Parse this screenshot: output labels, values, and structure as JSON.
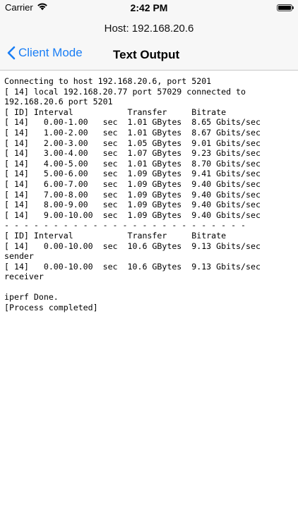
{
  "status_bar": {
    "carrier": "Carrier",
    "time": "2:42 PM",
    "wifi_icon": "wifi-icon",
    "battery_icon": "battery-icon"
  },
  "nav": {
    "host": "Host: 192.168.20.6",
    "back_label": "Client Mode",
    "title": "Text Output",
    "accent": "#1a7ef5"
  },
  "output_lines": [
    "Connecting to host 192.168.20.6, port 5201",
    "[ 14] local 192.168.20.77 port 57029 connected to",
    "192.168.20.6 port 5201",
    "[ ID] Interval           Transfer     Bitrate",
    "[ 14]   0.00-1.00   sec  1.01 GBytes  8.65 Gbits/sec",
    "[ 14]   1.00-2.00   sec  1.01 GBytes  8.67 Gbits/sec",
    "[ 14]   2.00-3.00   sec  1.05 GBytes  9.01 Gbits/sec",
    "[ 14]   3.00-4.00   sec  1.07 GBytes  9.23 Gbits/sec",
    "[ 14]   4.00-5.00   sec  1.01 GBytes  8.70 Gbits/sec",
    "[ 14]   5.00-6.00   sec  1.09 GBytes  9.41 Gbits/sec",
    "[ 14]   6.00-7.00   sec  1.09 GBytes  9.40 Gbits/sec",
    "[ 14]   7.00-8.00   sec  1.09 GBytes  9.40 Gbits/sec",
    "[ 14]   8.00-9.00   sec  1.09 GBytes  9.40 Gbits/sec",
    "[ 14]   9.00-10.00  sec  1.09 GBytes  9.40 Gbits/sec",
    "- - - - - - - - - - - - - - - - - - - - - - - - -",
    "[ ID] Interval           Transfer     Bitrate",
    "[ 14]   0.00-10.00  sec  10.6 GBytes  9.13 Gbits/sec",
    "sender",
    "[ 14]   0.00-10.00  sec  10.6 GBytes  9.13 Gbits/sec",
    "receiver",
    "",
    "iperf Done.",
    "[Process completed]"
  ]
}
